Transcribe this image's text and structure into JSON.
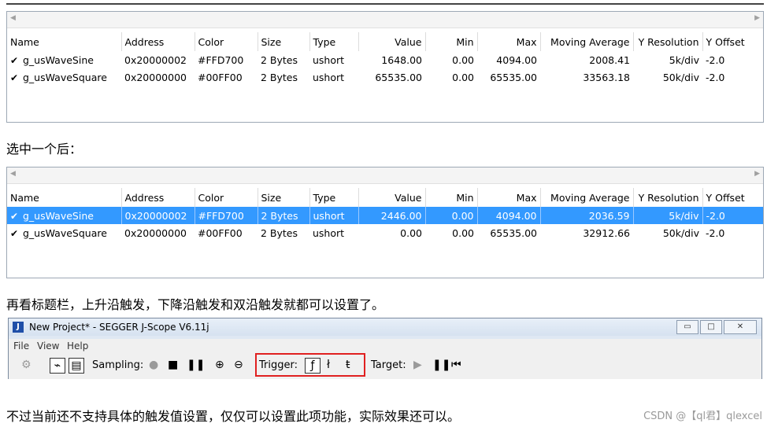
{
  "table_columns": [
    "Name",
    "Address",
    "Color",
    "Size",
    "Type",
    "Value",
    "Min",
    "Max",
    "Moving Average",
    "Y Resolution",
    "Y Offset"
  ],
  "table1_rows": [
    {
      "name": "g_usWaveSine",
      "address": "0x20000002",
      "color": "#FFD700",
      "size": "2 Bytes",
      "type": "ushort",
      "value": "1648.00",
      "min": "0.00",
      "max": "4094.00",
      "moving_average": "2008.41",
      "y_resolution": "5k/div",
      "y_offset": "-2.0"
    },
    {
      "name": "g_usWaveSquare",
      "address": "0x20000000",
      "color": "#00FF00",
      "size": "2 Bytes",
      "type": "ushort",
      "value": "65535.00",
      "min": "0.00",
      "max": "65535.00",
      "moving_average": "33563.18",
      "y_resolution": "50k/div",
      "y_offset": "-2.0"
    }
  ],
  "table2_rows": [
    {
      "name": "g_usWaveSine",
      "address": "0x20000002",
      "color": "#FFD700",
      "size": "2 Bytes",
      "type": "ushort",
      "value": "2446.00",
      "min": "0.00",
      "max": "4094.00",
      "moving_average": "2036.59",
      "y_resolution": "5k/div",
      "y_offset": "-2.0",
      "selected": true
    },
    {
      "name": "g_usWaveSquare",
      "address": "0x20000000",
      "color": "#00FF00",
      "size": "2 Bytes",
      "type": "ushort",
      "value": "0.00",
      "min": "0.00",
      "max": "65535.00",
      "moving_average": "32912.66",
      "y_resolution": "50k/div",
      "y_offset": "-2.0"
    }
  ],
  "caption1": "选中一个后：",
  "caption2": "再看标题栏，上升沿触发，下降沿触发和双沿触发就都可以设置了。",
  "caption3": "不过当前还不支持具体的触发值设置，仅仅可以设置此项功能，实际效果还可以。",
  "watermark": "CSDN @【ql君】qlexcel",
  "window": {
    "title": "New Project* - SEGGER J-Scope V6.11j",
    "menu": [
      "File",
      "View",
      "Help"
    ],
    "sampling_label": "Sampling:",
    "trigger_label": "Trigger:",
    "target_label": "Target:"
  },
  "colors": {
    "selection": "#3399ff",
    "highlight_box": "#e02020"
  },
  "icons": [
    "check-icon",
    "gear-icon",
    "line-chart-icon",
    "table-icon",
    "record-icon",
    "stop-icon",
    "pause-icon",
    "zoom-in-icon",
    "zoom-out-icon",
    "rising-edge-icon",
    "falling-edge-icon",
    "both-edges-icon",
    "play-icon",
    "step-back-icon"
  ]
}
